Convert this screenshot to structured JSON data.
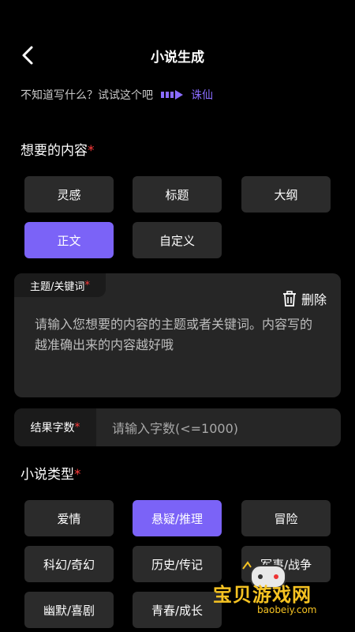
{
  "header": {
    "title": "小说生成"
  },
  "hint": {
    "text": "不知道写什么？试试这个吧",
    "link": "诛仙"
  },
  "content_section": {
    "title": "想要的内容",
    "options": [
      {
        "label": "灵感",
        "active": false
      },
      {
        "label": "标题",
        "active": false
      },
      {
        "label": "大纲",
        "active": false
      },
      {
        "label": "正文",
        "active": true
      },
      {
        "label": "自定义",
        "active": false
      }
    ]
  },
  "theme": {
    "label": "主题/关键词",
    "delete_label": "删除",
    "placeholder": "请输入您想要的内容的主题或者关键词。内容写的越准确出来的内容越好哦"
  },
  "word_count": {
    "label": "结果字数",
    "placeholder": "请输入字数(<=1000)"
  },
  "genre_section": {
    "title": "小说类型",
    "options": [
      {
        "label": "爱情",
        "active": false
      },
      {
        "label": "悬疑/推理",
        "active": true
      },
      {
        "label": "冒险",
        "active": false
      },
      {
        "label": "科幻/奇幻",
        "active": false
      },
      {
        "label": "历史/传记",
        "active": false
      },
      {
        "label": "军事/战争",
        "active": false
      },
      {
        "label": "幽默/喜剧",
        "active": false
      },
      {
        "label": "青春/成长",
        "active": false
      }
    ]
  },
  "watermark": {
    "text": "宝贝游戏网",
    "url": "baobeiy.com"
  },
  "required_mark": "*"
}
